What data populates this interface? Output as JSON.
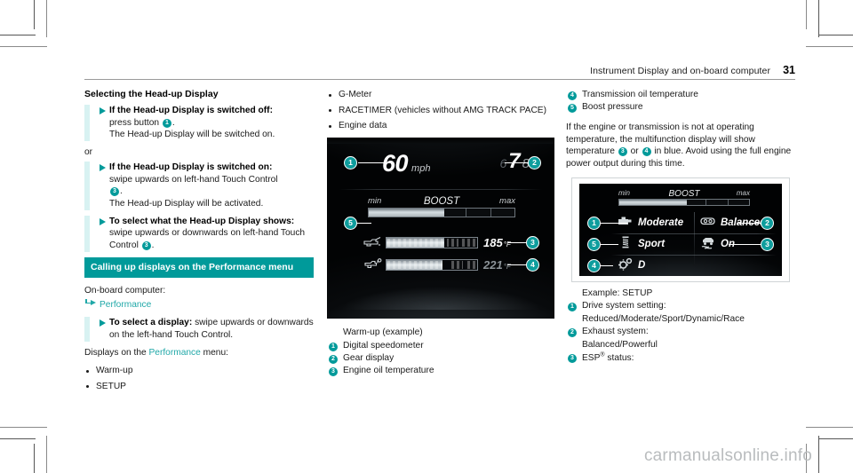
{
  "header": {
    "title": "Instrument Display and on-board computer",
    "page_number": "31"
  },
  "column_left": {
    "heading": "Selecting the Head-up Display",
    "steps": [
      {
        "bold": "If the Head-up Display is switched off:",
        "line2_a": "press button ",
        "badge": "1",
        "line2_b": ".",
        "line3": "The Head-up Display will be switched on."
      },
      {
        "bold": "If the Head-up Display is switched on:",
        "line2_a": "swipe upwards on left-hand Touch Control",
        "badge": "3",
        "line2_b": ".",
        "line3": "The Head-up Display will be activated."
      },
      {
        "bold": "To select what the Head-up Display shows:",
        "line2_a": " swipe upwards or downwards on left-hand Touch Control ",
        "badge": "3",
        "line2_b": "."
      }
    ],
    "or_label": "or",
    "section_heading": "Calling up displays on the Performance menu",
    "onboard_label": "On-board computer:",
    "menu_path": "Performance",
    "select_step": {
      "bold": "To select a display:",
      "rest": " swipe upwards or downwards on the left-hand Touch Control."
    },
    "displays_intro_a": "Displays on the ",
    "displays_intro_link": "Performance",
    "displays_intro_b": " menu:",
    "display_items": [
      "Warm-up",
      "SETUP"
    ]
  },
  "column_middle": {
    "continued_items": [
      "G-Meter",
      "RACETIMER (vehicles without AMG TRACK PACE)",
      "Engine data"
    ],
    "hud": {
      "speed_value": "60",
      "speed_unit": "mph",
      "gear_prev": "6",
      "gear_current": "7",
      "gear_next": "8",
      "boost_min": "min",
      "boost_title": "BOOST",
      "boost_max": "max",
      "boost_fill_percent": 52,
      "oil_temp_value": "185",
      "oil_temp_unit": "°F",
      "trans_temp_value": "221",
      "trans_temp_unit": "°F",
      "callouts": [
        "1",
        "2",
        "3",
        "4",
        "5"
      ]
    },
    "caption_title": "Warm-up (example)",
    "caption_items": [
      {
        "badge": "1",
        "text": "Digital speedometer"
      },
      {
        "badge": "2",
        "text": "Gear display"
      },
      {
        "badge": "3",
        "text": "Engine oil temperature"
      }
    ]
  },
  "column_right": {
    "caption_items_cont": [
      {
        "badge": "4",
        "text": "Transmission oil temperature"
      },
      {
        "badge": "5",
        "text": "Boost pressure"
      }
    ],
    "note_a": "If the engine or transmission is not at operating temperature, the multifunction display will show temperature ",
    "note_badge_1": "3",
    "note_b": " or ",
    "note_badge_2": "4",
    "note_c": " in blue. Avoid using the full engine power output during this time.",
    "setup": {
      "boost_min": "min",
      "boost_title": "BOOST",
      "boost_max": "max",
      "boost_fill_percent": 52,
      "cells": [
        {
          "icon": "engine-icon",
          "label": "Moderate"
        },
        {
          "icon": "exhaust-icon",
          "label": "Balanced"
        },
        {
          "icon": "suspension-icon",
          "label": "Sport"
        },
        {
          "icon": "esp-icon",
          "label": "On"
        },
        {
          "icon": "gear-transmission-icon",
          "label": "D"
        }
      ],
      "callouts": [
        "1",
        "2",
        "3",
        "4",
        "5"
      ]
    },
    "caption_title": "Example: SETUP",
    "caption_items": [
      {
        "badge": "1",
        "text": "Drive system setting:",
        "sub": "Reduced/Moderate/Sport/Dynamic/Race"
      },
      {
        "badge": "2",
        "text": "Exhaust system:",
        "sub": "Balanced/Powerful"
      },
      {
        "badge": "3",
        "text": "ESP® status:",
        "sub": ""
      }
    ]
  },
  "watermark": "carmanualsonline.info",
  "colors": {
    "teal": "#009a9a",
    "teal_light": "#20a8a8",
    "band": "#d8f2f2",
    "callout": "#0e9d9d"
  }
}
